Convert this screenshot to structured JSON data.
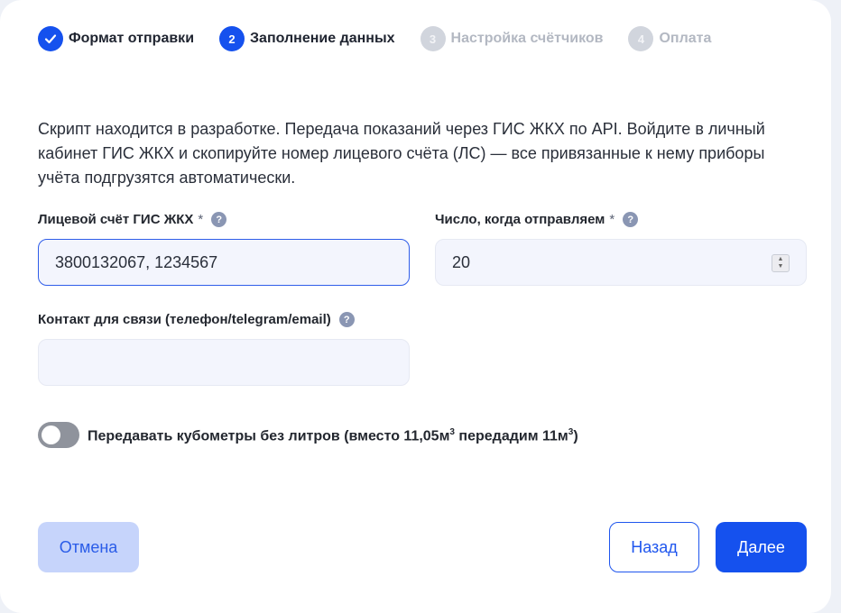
{
  "stepper": {
    "steps": [
      {
        "number": "✓",
        "label": "Формат отправки",
        "state": "done"
      },
      {
        "number": "2",
        "label": "Заполнение данных",
        "state": "active"
      },
      {
        "number": "3",
        "label": "Настройка счётчиков",
        "state": "pending"
      },
      {
        "number": "4",
        "label": "Оплата",
        "state": "pending"
      }
    ]
  },
  "description": "Скрипт находится в разработке. Передача показаний через ГИС ЖКХ по API. Войдите в личный кабинет ГИС ЖКХ и скопируйте номер лицевого счёта (ЛС) — все привязанные к нему приборы учёта подгрузятся автоматически.",
  "form": {
    "account": {
      "label": "Лицевой счёт ГИС ЖКХ",
      "required": "*",
      "value": "3800132067, 1234567"
    },
    "send_day": {
      "label": "Число, когда отправляем",
      "required": "*",
      "value": "20"
    },
    "contact": {
      "label": "Контакт для связи (телефон/telegram/email)",
      "value": ""
    },
    "help_glyph": "?"
  },
  "toggle": {
    "label_before": "Передавать кубометры без литров (вместо 11,05м",
    "sup1": "3",
    "label_middle": " передадим 11м",
    "sup2": "3",
    "label_after": ")",
    "on": false
  },
  "buttons": {
    "cancel": "Отмена",
    "back": "Назад",
    "next": "Далее"
  },
  "colors": {
    "accent": "#1551ee",
    "pending": "#d1d5dd",
    "input_bg": "#f3f5fd"
  }
}
